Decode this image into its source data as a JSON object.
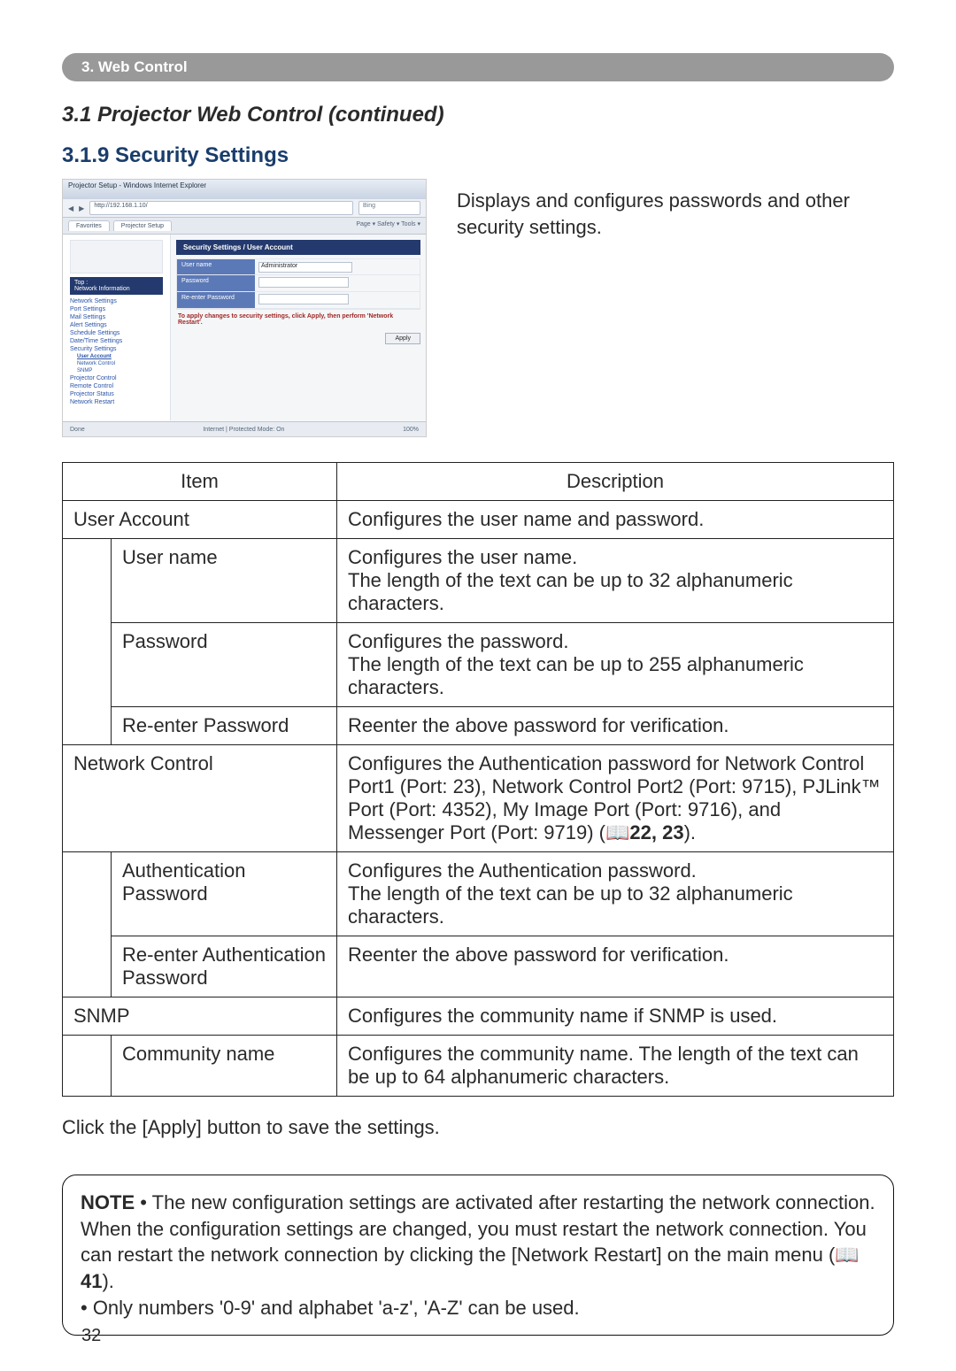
{
  "section_tab": "3. Web Control",
  "heading": "3.1 Projector Web Control (continued)",
  "subheading": "3.1.9 Security Settings",
  "intro": "Displays and configures passwords and other security settings.",
  "screenshot": {
    "window_title": "Projector Setup - Windows Internet Explorer",
    "url_text": "http://192.168.1.10/",
    "search_placeholder": "Bing",
    "tool_text": "Page ▾  Safety ▾  Tools ▾",
    "tab1": "Favorites",
    "tab2": "Projector Setup",
    "main_title": "Security Settings / User Account",
    "side_header": "Top :\nNetwork Information",
    "side_links": [
      "Network Settings",
      "Port Settings",
      "Mail Settings",
      "Alert Settings",
      "Schedule Settings",
      "Date/Time Settings",
      "Security Settings"
    ],
    "side_sublinks": [
      "User Account",
      "Network Control",
      "SNMP"
    ],
    "side_links2": [
      "Projector Control",
      "Remote Control",
      "Projector Status",
      "Network Restart"
    ],
    "form_rows": [
      "User name",
      "Password",
      "Re-enter Password"
    ],
    "form_value0": "Administrator",
    "apply_msg": "To apply changes to security settings, click Apply, then perform 'Network Restart'.",
    "apply_btn": "Apply",
    "status_left": "Done",
    "status_mid": "Internet | Protected Mode: On",
    "status_right": "100%"
  },
  "table": {
    "hdr_item": "Item",
    "hdr_desc": "Description",
    "rows": [
      {
        "item": "User Account",
        "desc": "Configures the user name and password.",
        "span": true
      },
      {
        "item": "User name",
        "desc": "Configures the user name.\nThe length of the text can be up to 32 alphanumeric characters."
      },
      {
        "item": "Password",
        "desc": "Configures the password.\nThe length of the text can be up to 255 alphanumeric characters."
      },
      {
        "item": "Re-enter Password",
        "desc": "Reenter the above password for verification."
      },
      {
        "item": "Network Control",
        "desc_pre": "Configures the Authentication password for Network Control Port1 (Port: 23), Network Control Port2 (Port: 9715), PJLink™ Port (Port: 4352), My Image Port (Port: 9716), and Messenger Port (Port: 9719) (",
        "desc_ref": "22, 23",
        "desc_post": ").",
        "span": true,
        "hasref": true
      },
      {
        "item": "Authentication Password",
        "desc": "Configures the Authentication password.\nThe length of the text can be up to 32 alphanumeric characters."
      },
      {
        "item": "Re-enter Authentication Password",
        "desc": "Reenter the above password for verification."
      },
      {
        "item": "SNMP",
        "desc": "Configures the community name if SNMP is used.",
        "span": true
      },
      {
        "item": "Community name",
        "desc": "Configures the community name. The length of the text can be up to 64 alphanumeric characters."
      }
    ]
  },
  "afternote": "Click the [Apply] button to save the settings.",
  "note": {
    "lead": "NOTE",
    "body1": " • The new configuration settings are activated after restarting the network connection. When the configuration settings are changed, you must restart the network connection. You can restart the network connection by clicking the [Network Restart] on the main menu (",
    "ref": "41",
    "body2": ").",
    "body3": "• Only numbers '0-9' and alphabet 'a-z', 'A-Z' can be used."
  },
  "page_number": "32",
  "icon_glyph": "📖"
}
